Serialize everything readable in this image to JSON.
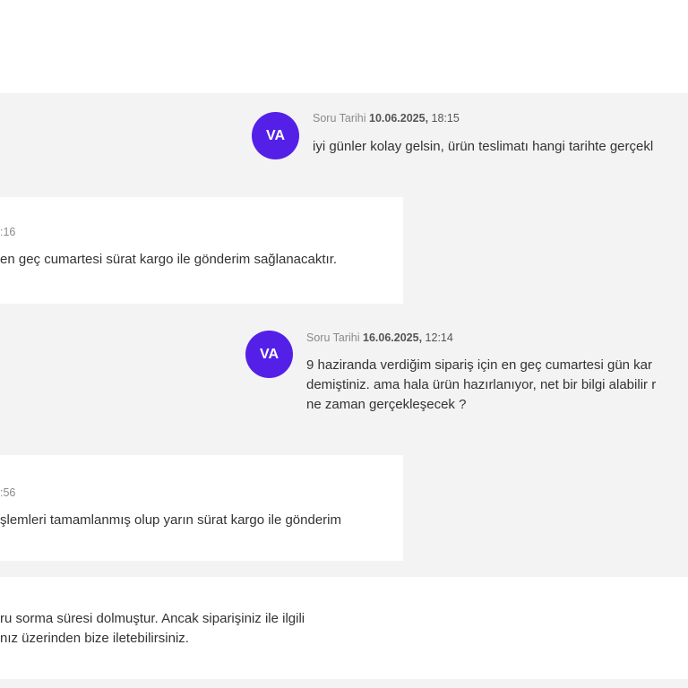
{
  "questions": [
    {
      "avatar": "VA",
      "label": "Soru Tarihi",
      "date": "10.06.2025,",
      "time": "18:15",
      "lines": [
        "iyi günler kolay gelsin, ürün teslimatı hangi tarihte gerçekl"
      ]
    },
    {
      "avatar": "VA",
      "label": "Soru Tarihi",
      "date": "16.06.2025,",
      "time": "12:14",
      "lines": [
        "9 haziranda verdiğim sipariş için en geç cumartesi gün kar",
        "demiştiniz. ama hala ürün hazırlanıyor, net bir bilgi alabilir r",
        "ne zaman gerçekleşecek ?"
      ]
    }
  ],
  "answers": [
    {
      "meta": ":16",
      "text": "en geç cumartesi sürat kargo ile gönderim sağlanacaktır."
    },
    {
      "meta": ":56",
      "text": "şlemleri tamamlanmış olup yarın sürat kargo ile gönderim"
    }
  ],
  "notice": {
    "lines": [
      "ru sorma süresi dolmuştur. Ancak siparişiniz ile ilgili",
      "nız üzerinden bize iletebilirsiniz."
    ]
  },
  "colors": {
    "accent": "#5420e8",
    "thread_bg": "#f3f3f3"
  }
}
